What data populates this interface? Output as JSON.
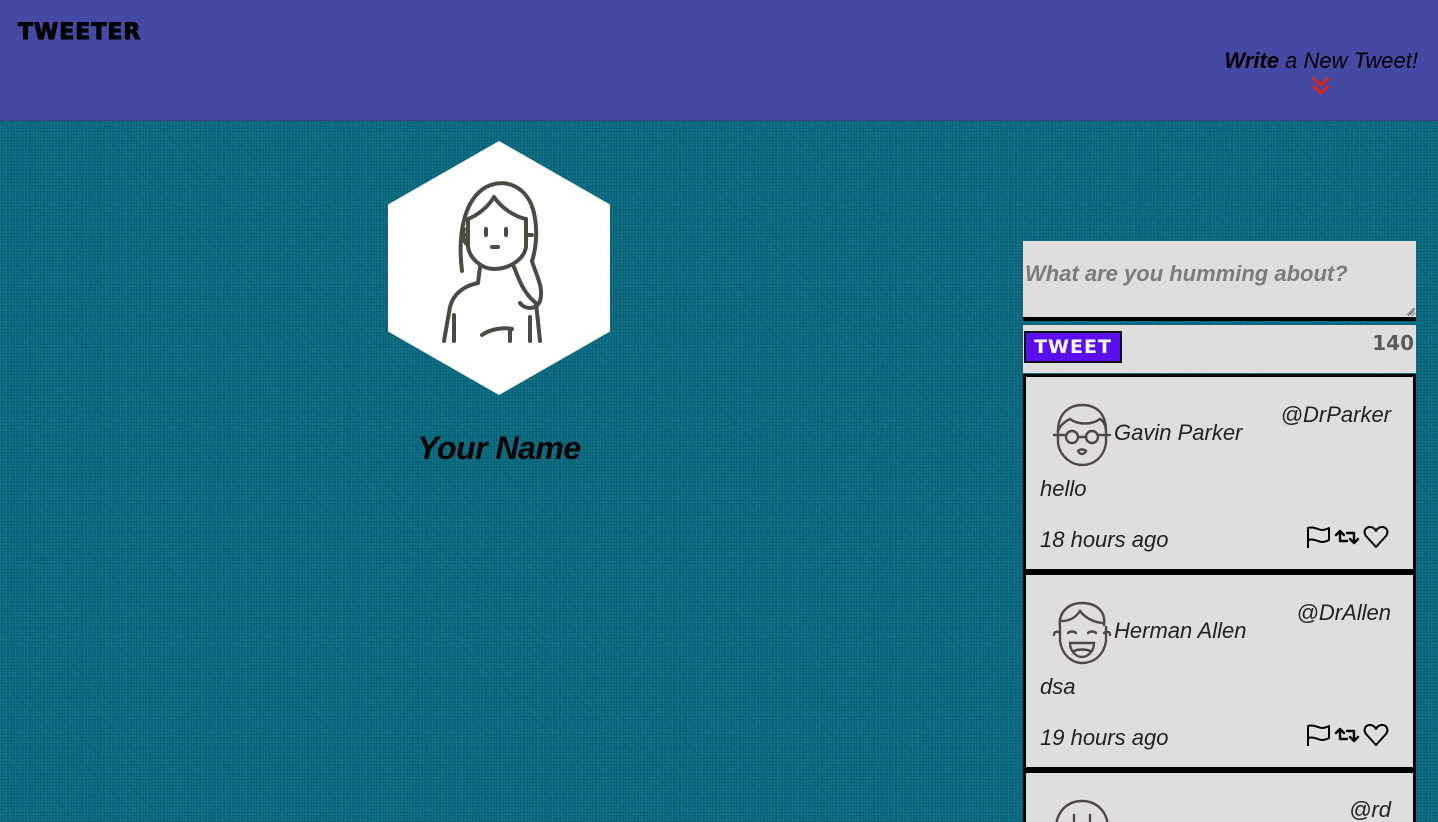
{
  "nav": {
    "brand": "TWEETER",
    "compose_bold": "Write",
    "compose_rest": " a New Tweet!",
    "chevron_icon": "double-chevron-down-icon",
    "chevron_color": "#e0231a"
  },
  "profile": {
    "name": "Your Name",
    "avatar_icon": "woman-avatar-icon"
  },
  "compose": {
    "placeholder": "What are you humming about?",
    "button_label": "TWEET",
    "counter": "140"
  },
  "tweets": [
    {
      "avatar_icon": "man-glasses-avatar-icon",
      "name": "Gavin Parker",
      "handle": "@DrParker",
      "text": "hello",
      "time": "18 hours ago"
    },
    {
      "avatar_icon": "laughing-man-avatar-icon",
      "name": "Herman Allen",
      "handle": "@DrAllen",
      "text": "dsa",
      "time": "19 hours ago"
    },
    {
      "avatar_icon": "avatar-icon",
      "name": "",
      "handle": "@rd",
      "text": "",
      "time": ""
    }
  ],
  "colors": {
    "nav_bg": "#4549a4",
    "page_bg": "#0a6a80",
    "card_bg": "#e0dedd",
    "tweet_button": "#5a10ee"
  }
}
